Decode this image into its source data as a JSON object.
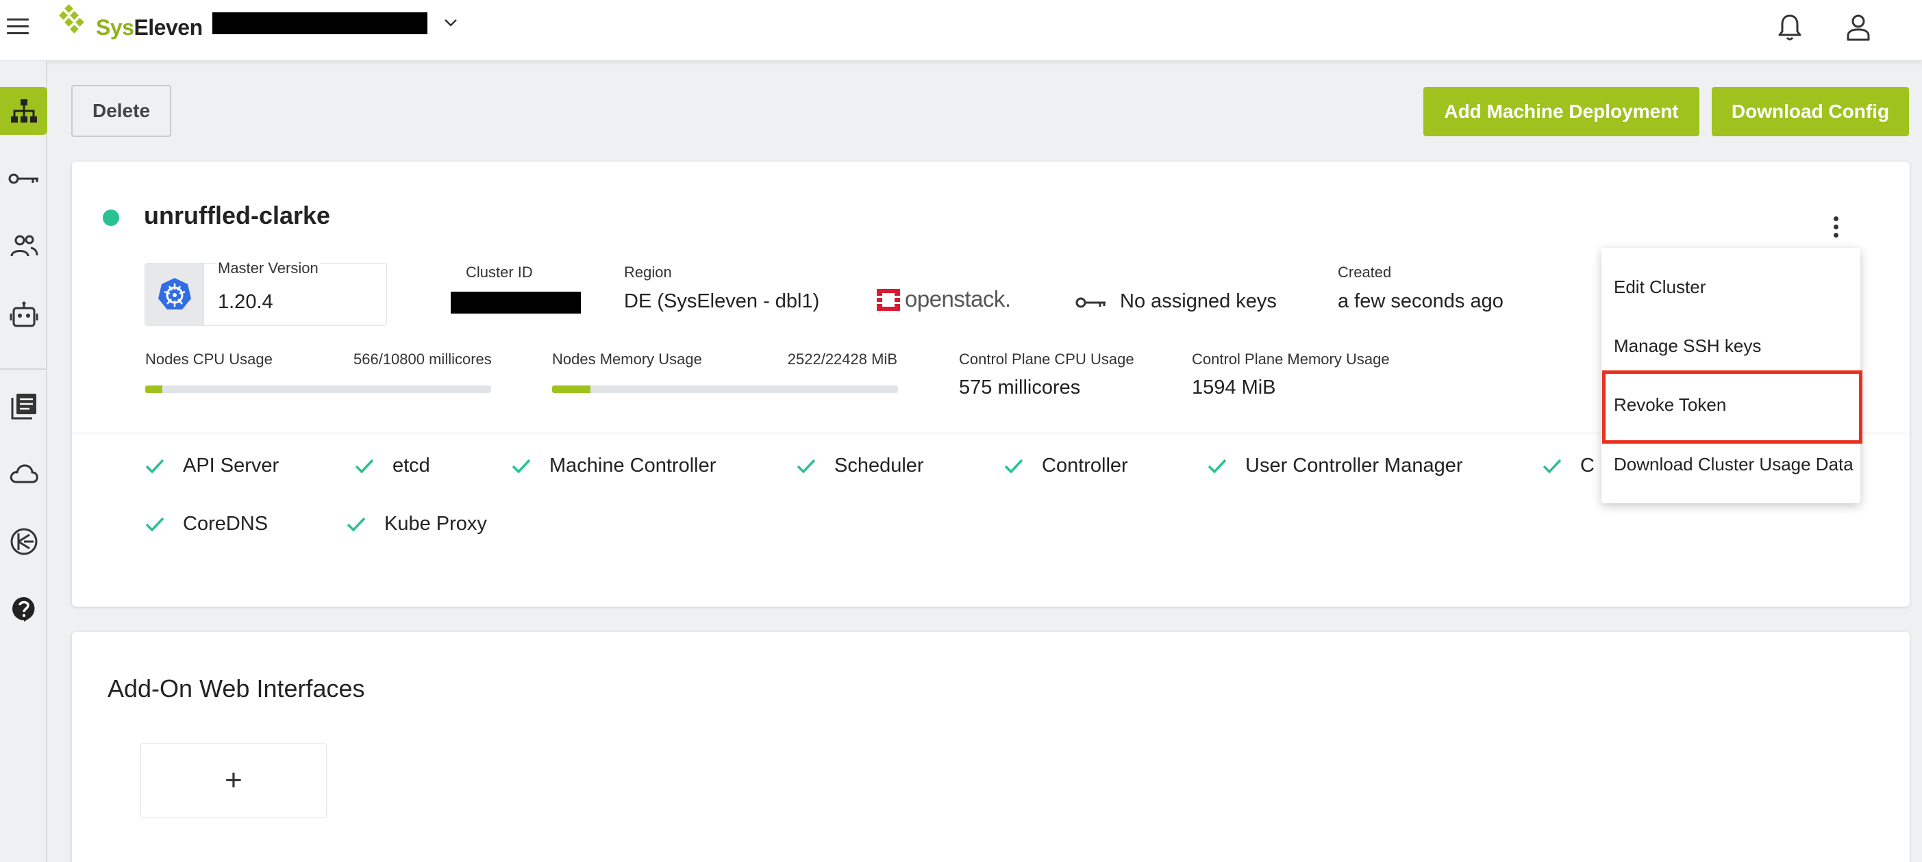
{
  "header": {
    "brand": "SysEleven",
    "project_selector_value": "[redacted]",
    "icons": [
      "menu-icon",
      "chevron-down-icon",
      "bell-icon",
      "user-icon"
    ]
  },
  "sidebar": {
    "items": [
      {
        "icon": "cluster-icon",
        "active": true
      },
      {
        "icon": "key-icon",
        "active": false
      },
      {
        "icon": "members-icon",
        "active": false
      },
      {
        "icon": "robot-icon",
        "active": false
      },
      {
        "icon": "docs-icon",
        "active": false
      },
      {
        "icon": "cloud-icon",
        "active": false
      },
      {
        "icon": "support-icon",
        "active": false
      },
      {
        "icon": "help-icon",
        "active": false
      }
    ]
  },
  "toolbar": {
    "delete_label": "Delete",
    "add_machine_deployment_label": "Add Machine Deployment",
    "download_config_label": "Download Config"
  },
  "cluster": {
    "status_color": "#27c28f",
    "name": "unruffled-clarke",
    "master_version_label": "Master Version",
    "master_version": "1.20.4",
    "cluster_id_label": "Cluster ID",
    "cluster_id": "[redacted]",
    "region_label": "Region",
    "region": "DE (SysEleven - dbl1)",
    "provider_logo_text": "openstack.",
    "ssh_keys_text": "No assigned keys",
    "created_label": "Created",
    "created": "a few seconds ago",
    "nodes_cpu_label": "Nodes CPU Usage",
    "nodes_cpu_value": "566/10800 millicores",
    "nodes_cpu_fraction": 0.05,
    "nodes_memory_label": "Nodes Memory Usage",
    "nodes_memory_value": "2522/22428 MiB",
    "nodes_memory_fraction": 0.11,
    "cp_cpu_label": "Control Plane CPU Usage",
    "cp_cpu_value": "575 millicores",
    "cp_memory_label": "Control Plane Memory Usage",
    "cp_memory_value": "1594 MiB",
    "health": [
      "API Server",
      "etcd",
      "Machine Controller",
      "Scheduler",
      "Controller",
      "User Controller Manager",
      "C",
      "CoreDNS",
      "Kube Proxy"
    ]
  },
  "menu": {
    "items": [
      "Edit Cluster",
      "Manage SSH keys",
      "Revoke Token",
      "Download Cluster Usage Data"
    ],
    "highlight_color": "#e8311f"
  },
  "addons": {
    "title": "Add-On Web Interfaces",
    "add_symbol": "+"
  },
  "colors": {
    "accent": "#9fc21f",
    "check": "#27c28f"
  }
}
